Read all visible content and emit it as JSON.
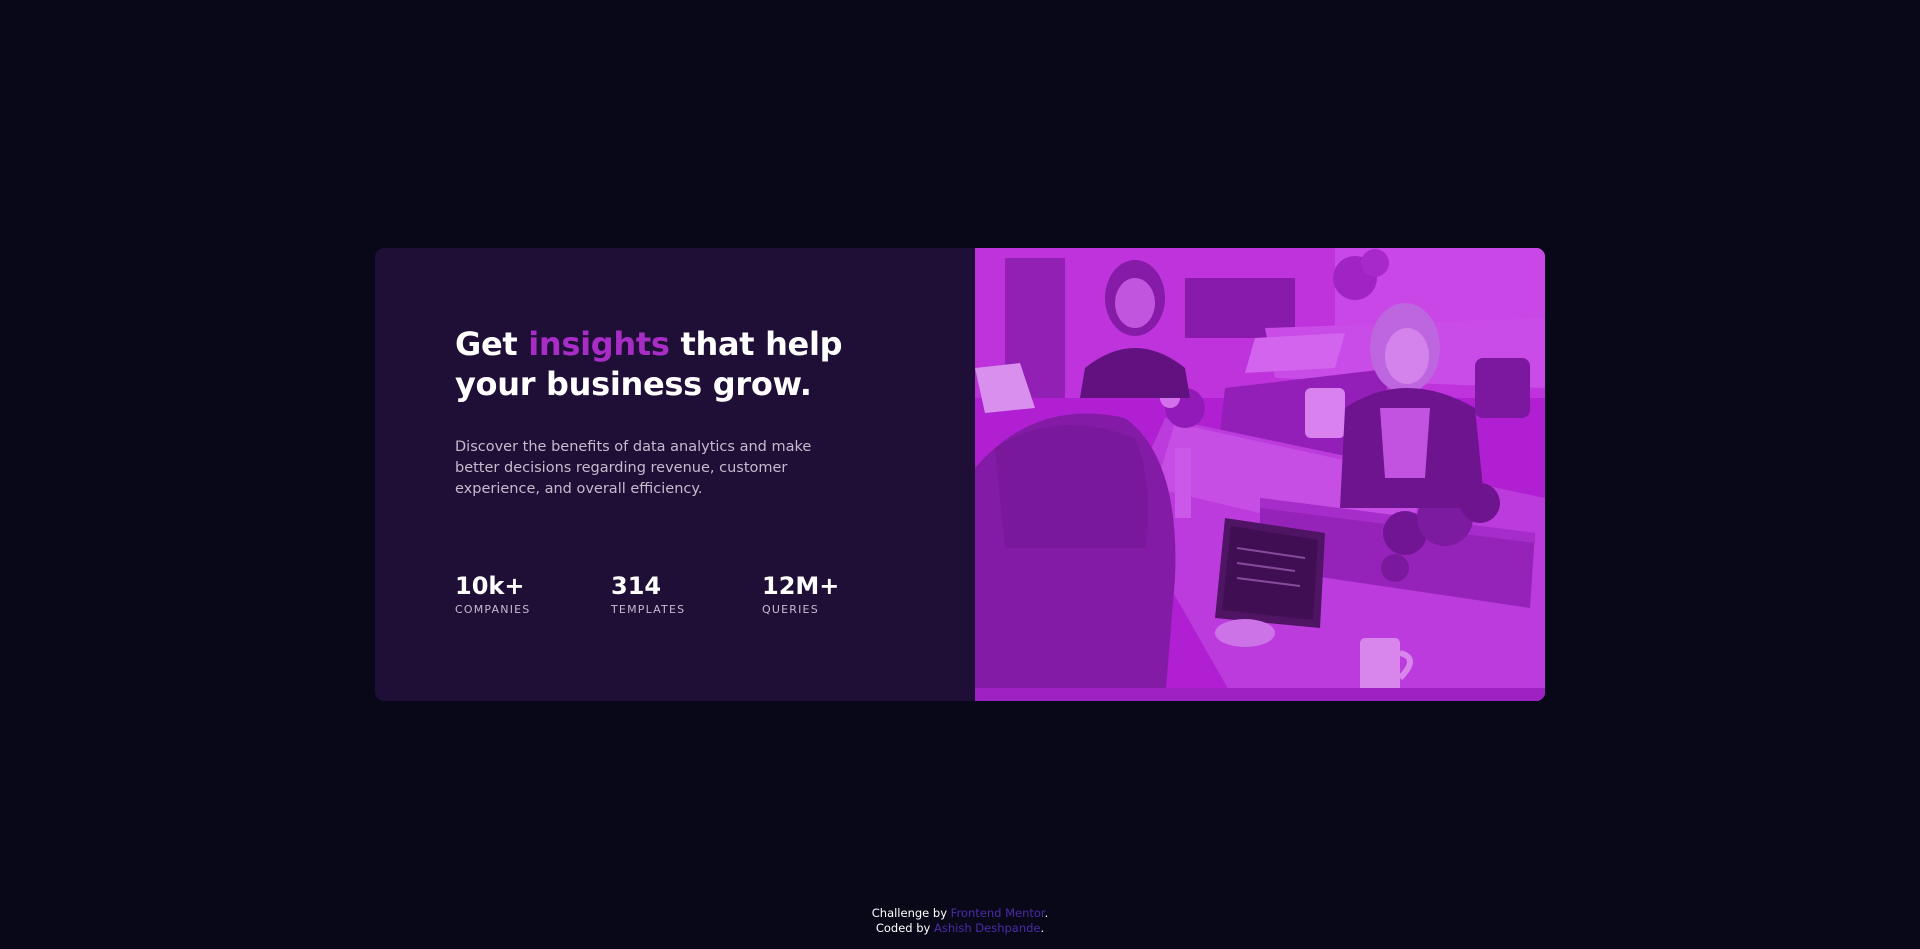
{
  "card": {
    "headline_part1": "Get ",
    "headline_accent": "insights",
    "headline_part2": " that help your business grow.",
    "description": "Discover the benefits of data analytics and make better decisions regarding revenue, customer experience, and overall efficiency.",
    "stats": [
      {
        "value": "10k+",
        "label": "COMPANIES"
      },
      {
        "value": "314",
        "label": "TEMPLATES"
      },
      {
        "value": "12M+",
        "label": "QUERIES"
      }
    ]
  },
  "attribution": {
    "challenge_prefix": "Challenge by ",
    "challenge_link": "Frontend Mentor",
    "coded_prefix": "Coded by ",
    "coded_link": "Ashish Deshpande",
    "period": "."
  },
  "colors": {
    "background": "#090818",
    "card": "#1f0e35",
    "accent": "#a82dc7",
    "image_overlay": "#aa20d1",
    "link": "#4c2ba7"
  }
}
